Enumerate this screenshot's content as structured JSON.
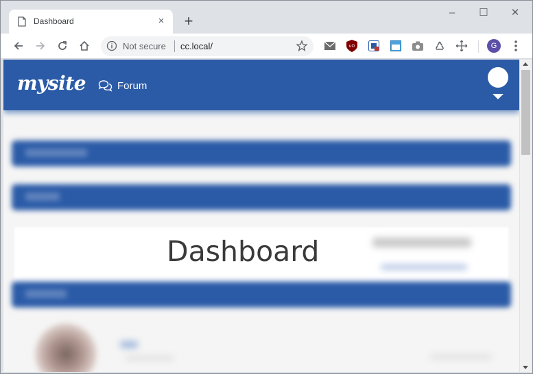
{
  "browser": {
    "tab_title": "Dashboard",
    "tab_close_glyph": "×",
    "new_tab_glyph": "+",
    "window_controls": {
      "minimize": "–",
      "maximize": "☐",
      "close": "✕"
    },
    "security_label": "Not secure",
    "url": "cc.local/",
    "profile_initial": "G",
    "icons": [
      "back-icon",
      "forward-icon",
      "reload-icon",
      "home-icon",
      "info-icon",
      "star-icon",
      "mail-icon",
      "ublock-icon",
      "extension-icon",
      "window-icon",
      "camera-icon",
      "recycle-icon",
      "move-icon",
      "menu-icon"
    ]
  },
  "site": {
    "brand": "mysite",
    "nav_forum": "Forum",
    "page_title": "Dashboard",
    "colors": {
      "header": "#2b5ba7",
      "background": "#f5f5f5"
    }
  }
}
